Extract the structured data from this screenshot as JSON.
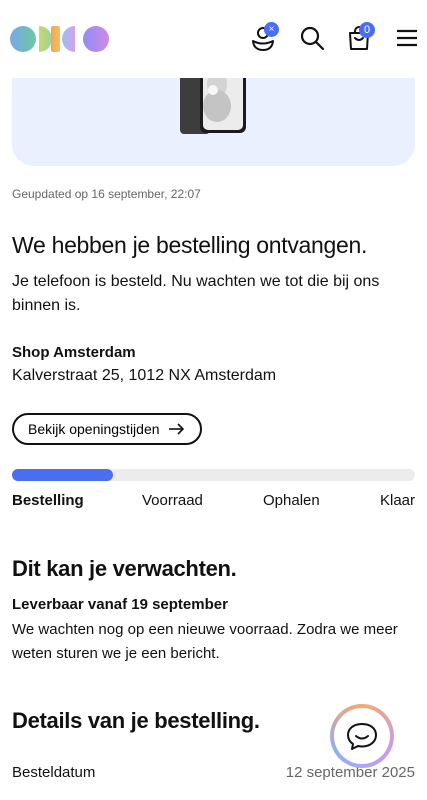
{
  "header": {
    "logo_icon": "odido-logo",
    "account_badge": "×",
    "cart_count": "0"
  },
  "status": {
    "updated": "Geupdated op 16 september, 22:07",
    "title": "We hebben je bestelling ontvangen.",
    "description": "Je telefoon is besteld. Nu wachten we tot die bij ons binnen is."
  },
  "shop": {
    "name": "Shop Amsterdam",
    "address": "Kalverstraat 25, 1012 NX Amsterdam",
    "hours_button": "Bekijk openingstijden"
  },
  "progress": {
    "fraction": 0.25,
    "steps": [
      "Bestelling",
      "Voorraad",
      "Ophalen",
      "Klaar"
    ],
    "accent": "#4b6df2"
  },
  "expect": {
    "heading": "Dit kan je verwachten.",
    "label": "Leverbaar vanaf 19 september",
    "text": "We wachten nog op een nieuwe voorraad. Zodra we meer weten sturen we je een bericht."
  },
  "details": {
    "heading": "Details van je bestelling.",
    "rows": [
      {
        "label": "Besteldatum",
        "value": "12 september 2025"
      }
    ]
  }
}
